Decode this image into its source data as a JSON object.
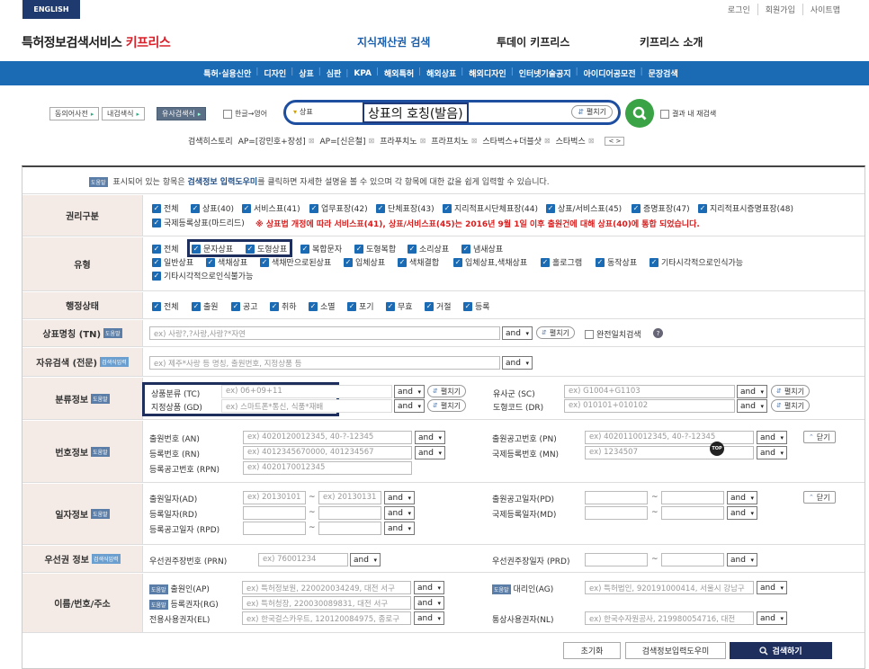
{
  "utility": {
    "english": "ENGLISH",
    "links": [
      "로그인",
      "회원가입",
      "사이트맵"
    ]
  },
  "logo": {
    "prefix": "특허정보검색서비스 ",
    "brand": "키프리스"
  },
  "gnb": [
    "지식재산권 검색",
    "투데이 키프리스",
    "키프리스 소개"
  ],
  "subnav": [
    "특허·실용신안",
    "디자인",
    "상표",
    "심판",
    "KPA",
    "해외특허",
    "해외상표",
    "해외디자인",
    "인터넷기술공지",
    "아이디어공모전",
    "문장검색"
  ],
  "search": {
    "pre_buttons": [
      "동의어사전",
      "내검색식",
      "유사검색식"
    ],
    "hangul_toggle": "한글→영어",
    "field_select": "상표",
    "query_highlight": "상표의 호칭(발음)",
    "expand": "펼치기",
    "research": "결과 내 재검색"
  },
  "history": {
    "label": "검색히스토리",
    "items": [
      "AP=[강민호+장성]",
      "AP=[신은철]",
      "프라푸치노",
      "프라프치노",
      "스타벅스+더블샷",
      "스타벅스"
    ]
  },
  "notice": {
    "tag": "도움말",
    "pre": " 표시되어 있는 항목은 ",
    "bold": "검색정보 입력도우미",
    "post": "를 클릭하면 자세한 설명을 볼 수 있으며 각 항목에 대한 값을 쉽게 입력할 수 있습니다."
  },
  "rights": {
    "label": "권리구분",
    "items": [
      "전체",
      "상표(40)",
      "서비스표(41)",
      "업무표장(42)",
      "단체표장(43)",
      "지리적표시단체표장(44)",
      "상표/서비스표(45)",
      "증명표장(47)",
      "지리적표시증명표장(48)",
      "국제등록상표(마드리드)"
    ],
    "warning": "※ 상표법 개정에 따라 서비스표(41), 상표/서비스표(45)는 2016년 9월 1일 이후 출원건에 대해 상표(40)에 통합 되었습니다."
  },
  "types": {
    "label": "유형",
    "items": [
      "전체",
      "문자상표",
      "도형상표",
      "복합문자",
      "도형복합",
      "소리상표",
      "냄새상표",
      "일반상표",
      "색채상표",
      "색채만으로된상표",
      "입체상표",
      "색채결합",
      "입체상표,색채상표",
      "홀로그램",
      "동작상표",
      "기타시각적으로인식가능",
      "기타시각적으로인식불가능"
    ]
  },
  "status": {
    "label": "행정상태",
    "items": [
      "전체",
      "출원",
      "공고",
      "취하",
      "소멸",
      "포기",
      "무효",
      "거절",
      "등록"
    ]
  },
  "tn": {
    "label": "상표명칭 (TN)",
    "tag": "도움말",
    "placeholder": "ex) 사랑?,?사랑,사랑?*자연",
    "op": "and",
    "expand": "펼치기",
    "exact": "완전일치검색",
    "q": "?"
  },
  "free": {
    "label": "자유검색 (전문)",
    "tag": "검색식입력",
    "placeholder": "ex) 제주*사랑 등 명칭, 출원번호, 지정상품 등",
    "op": "and"
  },
  "cls": {
    "label": "분류정보",
    "tag": "도움말",
    "tc": {
      "label": "상품분류 (TC)",
      "placeholder": "ex) 06+09+11",
      "op": "and",
      "expand": "펼치기"
    },
    "gd": {
      "label": "지정상품 (GD)",
      "placeholder": "ex) 스마트폰*통신, 식품*재배",
      "op": "and",
      "expand": "펼치기"
    },
    "sc": {
      "label": "유사군 (SC)",
      "placeholder": "ex) G1004+G1103",
      "op": "and",
      "expand": "펼치기"
    },
    "dr": {
      "label": "도형코드 (DR)",
      "placeholder": "ex) 010101+010102",
      "op": "and",
      "expand": "펼치기"
    }
  },
  "numbers": {
    "label": "번호정보",
    "tag": "도움말",
    "an": {
      "label": "출원번호 (AN)",
      "placeholder": "ex) 4020120012345, 40-?-12345",
      "op": "and"
    },
    "rn": {
      "label": "등록번호 (RN)",
      "placeholder": "ex) 4012345670000, 401234567",
      "op": "and"
    },
    "rpn": {
      "label": "등록공고번호 (RPN)",
      "placeholder": "ex) 4020170012345"
    },
    "pn": {
      "label": "출원공고번호 (PN)",
      "placeholder": "ex) 4020110012345, 40-?-12345",
      "op": "and"
    },
    "mn": {
      "label": "국제등록번호 (MN)",
      "placeholder": "ex) 1234507",
      "op": "and"
    },
    "close": "닫기",
    "top": "TOP"
  },
  "dates": {
    "label": "일자정보",
    "tag": "도움말",
    "ad": {
      "label": "출원일자(AD)",
      "from": "ex) 20130101",
      "to": "ex) 20130131",
      "op": "and"
    },
    "rd": {
      "label": "등록일자(RD)",
      "op": "and"
    },
    "rpd": {
      "label": "등록공고일자 (RPD)",
      "op": "and"
    },
    "pd": {
      "label": "출원공고일자(PD)",
      "op": "and"
    },
    "md": {
      "label": "국제등록일자(MD)",
      "op": "and"
    },
    "tilde": "~",
    "close": "닫기"
  },
  "priority": {
    "label": "우선권 정보",
    "tag": "검색식입력",
    "prn": {
      "label": "우선권주장번호 (PRN)",
      "placeholder": "ex) 76001234",
      "op": "and"
    },
    "prd": {
      "label": "우선권주장일자 (PRD)",
      "op": "and"
    },
    "tilde": "~"
  },
  "persons": {
    "label": "이름/번호/주소",
    "tag": "도움말",
    "ap": {
      "label": "출원인(AP)",
      "placeholder": "ex) 특허정보원, 220020034249, 대전 서구",
      "op": "and"
    },
    "rg": {
      "label": "등록권자(RG)",
      "placeholder": "ex) 특허청장, 220030089831, 대전 서구",
      "op": "and"
    },
    "el": {
      "label": "전용사용권자(EL)",
      "placeholder": "ex) 한국걸스카우트, 120120084975, 종로구",
      "op": "and"
    },
    "ag": {
      "label": "대리인(AG)",
      "placeholder": "ex) 특허법인, 920191000414, 서울시 강남구",
      "op": "and"
    },
    "nl": {
      "label": "통상사용권자(NL)",
      "placeholder": "ex) 한국수자원공사, 219980054716, 대전",
      "op": "and"
    }
  },
  "actions": {
    "reset": "초기화",
    "helper": "검색정보입력도우미",
    "search": "검색하기"
  }
}
